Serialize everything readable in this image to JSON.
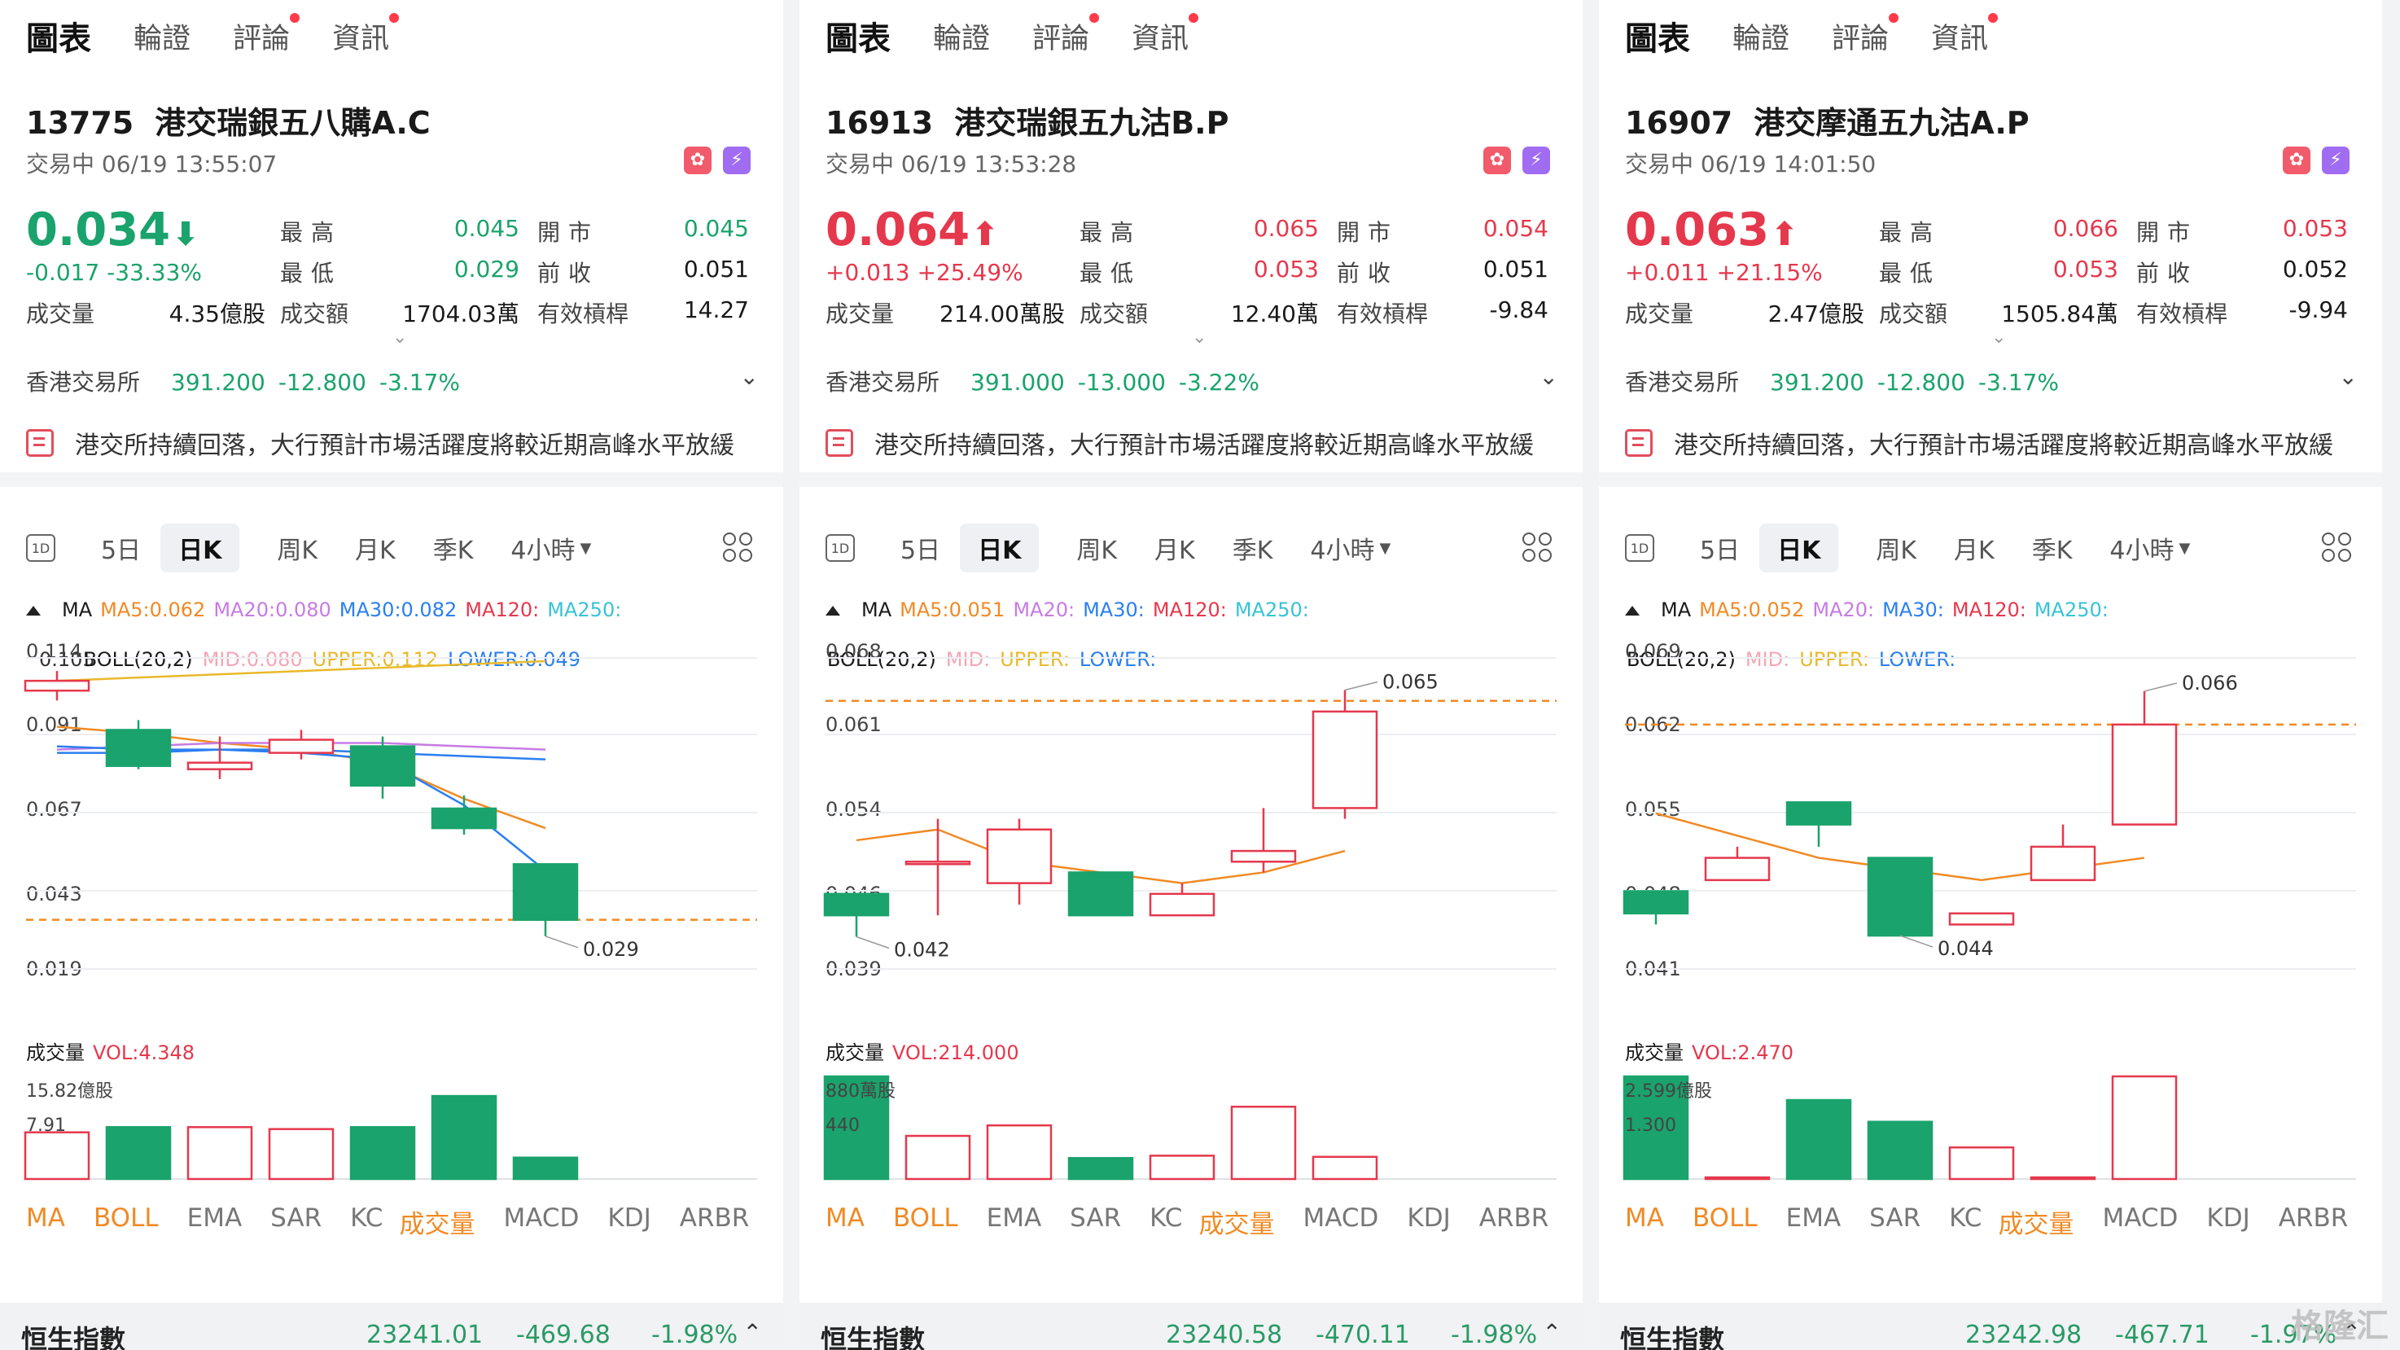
{
  "colors": {
    "up": "#e5384d",
    "down": "#1aa36c",
    "ma5": "#f08a24",
    "ma20": "#c77be5",
    "ma30": "#2a7ff0",
    "ma120": "#e5384d",
    "ma250": "#37c3d6",
    "mid": "#f4a6b4",
    "upper": "#e8b92a",
    "lower": "#2a7ff0"
  },
  "tabs": [
    "圖表",
    "輪證",
    "評論",
    "資訊"
  ],
  "indicator_tabs": [
    "MA",
    "BOLL",
    "EMA",
    "SAR",
    "KC",
    "成交量",
    "MACD",
    "KDJ",
    "ARBR"
  ],
  "periods": [
    "1D",
    "5日",
    "日K",
    "周K",
    "月K",
    "季K",
    "4小時"
  ],
  "labels": {
    "high": "最高",
    "open": "開市",
    "low": "最低",
    "prev": "前收",
    "volume": "成交量",
    "turnover": "成交額",
    "lev": "有效槓桿",
    "market": "香港交易所",
    "vol_title": "成交量",
    "ma": "MA",
    "boll": "BOLL(20,2)",
    "bottom_title": "恒生指數",
    "news": "港交所持續回落，大行預計市場活躍度將較近期高峰水平放緩",
    "watermark": "格隆汇"
  },
  "panels": [
    {
      "code": "13775",
      "name": "港交瑞銀五八購A.C",
      "status": "交易中 06/19 13:55:07",
      "price": "0.034",
      "arrow": "⬇",
      "dir": "dn",
      "change": "-0.017 -33.33%",
      "high": "0.045",
      "open": "0.045",
      "low": "0.029",
      "prev": "0.051",
      "volume": "4.35億股",
      "turnover": "1704.03萬",
      "lev": "14.27",
      "mkt_price": "391.200",
      "mkt_chg": "-12.800",
      "mkt_pct": "-3.17%",
      "ma": {
        "ma5": "MA5:0.062",
        "ma20": "MA20:0.080",
        "ma30": "MA30:0.082",
        "ma120": "MA120:",
        "ma250": "MA250:"
      },
      "boll": {
        "mid": "MID:0.080",
        "upper": "UPPER:0.112",
        "lower": "LOWER:0.049"
      },
      "boll_overlap": "0.105",
      "axis": [
        "0.114",
        "0.091",
        "0.067",
        "0.043",
        "0.019"
      ],
      "hi_label": "",
      "lo_label": "0.029",
      "vol": {
        "label": "VOL:4.348",
        "top": "15.82億股",
        "mid": "7.91"
      },
      "bottom": {
        "v1": "23241.01",
        "v2": "-469.68",
        "v3": "-1.98%"
      },
      "chart_data": {
        "type": "candlestick",
        "y_range": [
          0.019,
          0.114
        ],
        "candles": [
          [
            0.107,
            0.104,
            0.11,
            0.101,
            "up"
          ],
          [
            0.092,
            0.081,
            0.095,
            0.08,
            "dn"
          ],
          [
            0.08,
            0.082,
            0.09,
            0.077,
            "up"
          ],
          [
            0.085,
            0.089,
            0.092,
            0.083,
            "up"
          ],
          [
            0.087,
            0.075,
            0.09,
            0.071,
            "dn"
          ],
          [
            0.068,
            0.062,
            0.072,
            0.06,
            "dn"
          ],
          [
            0.051,
            0.034,
            0.051,
            0.029,
            "dn"
          ]
        ],
        "ref_line": 0.034,
        "volumes": [
          7.2,
          8.0,
          8.0,
          7.7,
          8.0,
          12.8,
          3.3
        ],
        "vol_max": 15.82,
        "ma_lines": {
          "ma5": [
            0.093,
            0.091,
            0.088,
            0.086,
            0.082,
            0.071,
            0.062
          ],
          "ma20": [
            0.086,
            0.087,
            0.088,
            0.088,
            0.088,
            0.087,
            0.086
          ],
          "ma30": [
            0.085,
            0.085,
            0.086,
            0.086,
            0.085,
            0.084,
            0.083
          ],
          "upper": [
            0.107,
            0.108,
            0.109,
            0.11,
            0.111,
            0.112,
            0.113
          ],
          "lower": [
            0.087,
            0.086,
            0.086,
            0.085,
            0.083,
            0.069,
            0.049
          ]
        }
      }
    },
    {
      "code": "16913",
      "name": "港交瑞銀五九沽B.P",
      "status": "交易中 06/19 13:53:28",
      "price": "0.064",
      "arrow": "⬆",
      "dir": "up",
      "change": "+0.013 +25.49%",
      "high": "0.065",
      "open": "0.054",
      "low": "0.053",
      "prev": "0.051",
      "volume": "214.00萬股",
      "turnover": "12.40萬",
      "lev": "-9.84",
      "mkt_price": "391.000",
      "mkt_chg": "-13.000",
      "mkt_pct": "-3.22%",
      "ma": {
        "ma5": "MA5:0.051",
        "ma20": "MA20:",
        "ma30": "MA30:",
        "ma120": "MA120:",
        "ma250": "MA250:"
      },
      "boll": {
        "mid": "MID:",
        "upper": "UPPER:",
        "lower": "LOWER:"
      },
      "boll_overlap": "",
      "axis": [
        "0.068",
        "0.061",
        "0.054",
        "0.046",
        "0.039"
      ],
      "hi_label": "0.065",
      "lo_label": "0.042",
      "vol": {
        "label": "VOL:214.000",
        "top": "880萬股",
        "mid": "440"
      },
      "bottom": {
        "v1": "23240.58",
        "v2": "-470.11",
        "v3": "-1.98%"
      },
      "chart_data": {
        "type": "candlestick",
        "y_range": [
          0.039,
          0.068
        ],
        "candles": [
          [
            0.046,
            0.044,
            0.046,
            0.042,
            "dn"
          ],
          [
            0.049,
            0.049,
            0.053,
            0.044,
            "up"
          ],
          [
            0.047,
            0.052,
            0.053,
            0.045,
            "up"
          ],
          [
            0.048,
            0.044,
            0.048,
            0.044,
            "dn"
          ],
          [
            0.044,
            0.046,
            0.047,
            0.044,
            "up"
          ],
          [
            0.05,
            0.049,
            0.054,
            0.048,
            "up"
          ],
          [
            0.054,
            0.063,
            0.065,
            0.053,
            "up"
          ]
        ],
        "ref_line": 0.064,
        "volumes": [
          880,
          370,
          460,
          180,
          200,
          620,
          190
        ],
        "vol_max": 880,
        "ma_lines": {
          "ma5": [
            0.051,
            0.052,
            0.049,
            0.048,
            0.047,
            0.048,
            0.05
          ]
        }
      }
    },
    {
      "code": "16907",
      "name": "港交摩通五九沽A.P",
      "status": "交易中 06/19 14:01:50",
      "price": "0.063",
      "arrow": "⬆",
      "dir": "up",
      "change": "+0.011 +21.15%",
      "high": "0.066",
      "open": "0.053",
      "low": "0.053",
      "prev": "0.052",
      "volume": "2.47億股",
      "turnover": "1505.84萬",
      "lev": "-9.94",
      "mkt_price": "391.200",
      "mkt_chg": "-12.800",
      "mkt_pct": "-3.17%",
      "ma": {
        "ma5": "MA5:0.052",
        "ma20": "MA20:",
        "ma30": "MA30:",
        "ma120": "MA120:",
        "ma250": "MA250:"
      },
      "boll": {
        "mid": "MID:",
        "upper": "UPPER:",
        "lower": "LOWER:"
      },
      "boll_overlap": "",
      "axis": [
        "0.069",
        "0.062",
        "0.055",
        "0.048",
        "0.041"
      ],
      "hi_label": "0.066",
      "lo_label": "0.044",
      "vol": {
        "label": "VOL:2.470",
        "top": "2.599億股",
        "mid": "1.300"
      },
      "bottom": {
        "v1": "23242.98",
        "v2": "-467.71",
        "v3": "-1.97%"
      },
      "chart_data": {
        "type": "candlestick",
        "y_range": [
          0.041,
          0.069
        ],
        "candles": [
          [
            0.048,
            0.046,
            0.048,
            0.045,
            "dn"
          ],
          [
            0.049,
            0.051,
            0.052,
            0.049,
            "up"
          ],
          [
            0.056,
            0.054,
            0.056,
            0.052,
            "dn"
          ],
          [
            0.051,
            0.044,
            0.051,
            0.044,
            "dn"
          ],
          [
            0.045,
            0.046,
            0.046,
            0.045,
            "up"
          ],
          [
            0.049,
            0.052,
            0.054,
            0.049,
            "up"
          ],
          [
            0.054,
            0.063,
            0.066,
            0.054,
            "up"
          ]
        ],
        "ref_line": 0.063,
        "volumes": [
          2.599,
          0.02,
          2.0,
          1.45,
          0.8,
          0.03,
          2.6
        ],
        "vol_max": 2.599,
        "ma_lines": {
          "ma5": [
            0.055,
            0.053,
            0.051,
            0.05,
            0.049,
            0.05,
            0.051
          ]
        }
      }
    }
  ]
}
